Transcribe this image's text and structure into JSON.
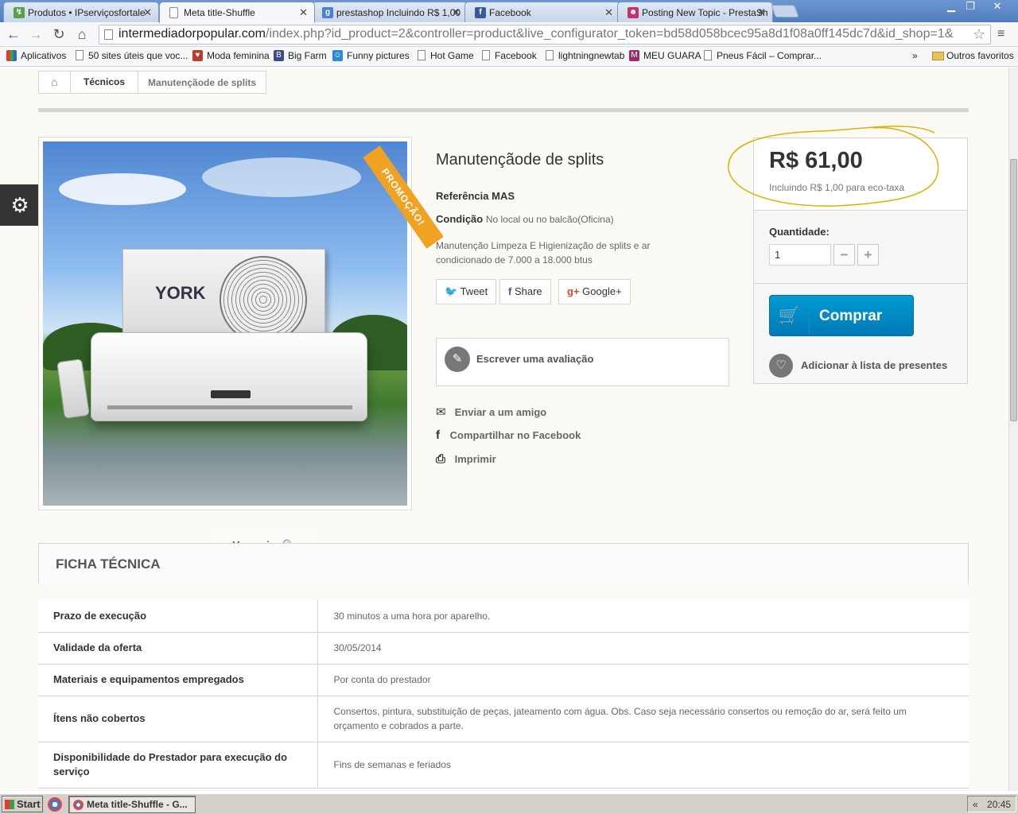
{
  "browser": {
    "tabs": [
      {
        "title": "Produtos • IPserviçosfortale",
        "icon": "green"
      },
      {
        "title": "Meta title-Shuffle",
        "icon": "page"
      },
      {
        "title": "prestashop Incluindo R$ 1,00",
        "icon": "google"
      },
      {
        "title": "Facebook",
        "icon": "facebook"
      },
      {
        "title": "Posting New Topic - PrestaSh",
        "icon": "prestashop"
      }
    ],
    "url_domain": "intermediadorpopular.com",
    "url_path": "/index.php?id_product=2&controller=product&live_configurator_token=bd58d058bcec95a8d1f08a0ff145dc7d&id_shop=1&",
    "bookmarks": [
      "Aplicativos",
      "50 sites úteis que voc...",
      "Moda feminina",
      "Big Farm",
      "Funny pictures",
      "Hot Game",
      "Facebook",
      "lightningnewtab",
      "MEU GUARA",
      "Pneus Fácil – Comprar..."
    ],
    "bookmarks_more": "»",
    "other_bookmarks": "Outros favoritos"
  },
  "breadcrumb": {
    "category": "Técnicos",
    "current": "Manutençãode de splits"
  },
  "product": {
    "ribbon": "PROMOÇÃO!",
    "image_brand": "YORK",
    "zoom_label": "Ver maior",
    "title": "Manutençãode de splits",
    "reference_label": "Referência",
    "reference_value": "MAS",
    "condition_label": "Condição",
    "condition_value": "No local ou no balcão(Oficina)",
    "description": "Manutenção Limpeza E Higienização de splits e ar condicionado de 7.000 a 18.000 btus",
    "social": {
      "tweet": "Tweet",
      "share": "Share",
      "google": "Google+"
    },
    "review_label": "Escrever uma avaliação",
    "actions": {
      "send_friend": "Enviar a um amigo",
      "share_facebook": "Compartilhar no Facebook",
      "print": "Imprimir"
    }
  },
  "buybox": {
    "price": "R$ 61,00",
    "ecotax": "Incluindo R$ 1,00 para eco-taxa",
    "quantity_label": "Quantidade:",
    "quantity_value": "1",
    "minus": "−",
    "plus": "+",
    "buy_label": "Comprar",
    "wishlist_label": "Adicionar à lista de presentes"
  },
  "ficha": {
    "heading": "FICHA TÉCNICA",
    "rows": [
      {
        "key": "Prazo de execução",
        "value": "30 minutos a uma hora por aparelho."
      },
      {
        "key": "Validade da oferta",
        "value": "30/05/2014"
      },
      {
        "key": "Materiais e equipamentos empregados",
        "value": "Por conta do prestador"
      },
      {
        "key": "Ítens não cobertos",
        "value": "Consertos, pintura, substituição de peças, jateamento com água. Obs. Caso seja necessário consertos ou remoção do ar, será feito um orçamento e cobrados a parte."
      },
      {
        "key": "Disponibilidade do Prestador para execução do serviço",
        "value": "Fins de semanas e feriados"
      }
    ]
  },
  "taskbar": {
    "start": "Start",
    "window_title": "Meta title-Shuffle - G...",
    "tray_arrow": "«",
    "clock": "20:45"
  },
  "colors": {
    "buy_button": "#0085c3",
    "ribbon": "#f0a223",
    "annotation_circle": "#d9b400"
  }
}
